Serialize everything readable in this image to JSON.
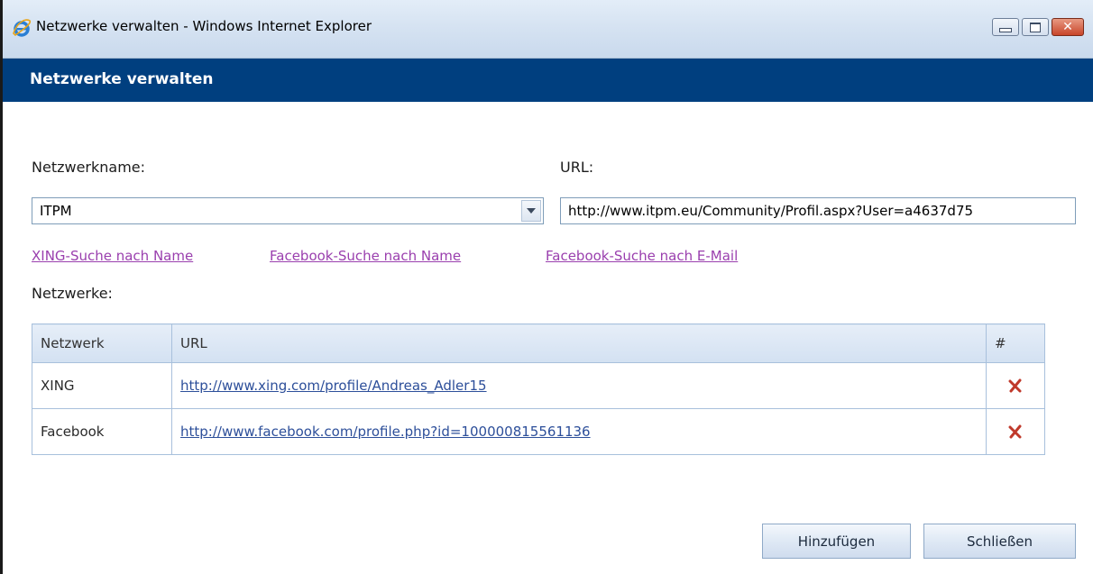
{
  "window": {
    "title": "Netzwerke verwalten - Windows Internet Explorer",
    "close_glyph": "✕"
  },
  "dialog": {
    "header": "Netzwerke verwalten"
  },
  "form": {
    "network_name_label": "Netzwerkname:",
    "network_name_value": "ITPM",
    "url_label": "URL:",
    "url_value": "http://www.itpm.eu/Community/Profil.aspx?User=a4637d75"
  },
  "links": {
    "xing_search": "XING-Suche nach Name",
    "facebook_search_name": "Facebook-Suche nach Name",
    "facebook_search_email": "Facebook-Suche nach E-Mail"
  },
  "networks": {
    "label": "Netzwerke:",
    "columns": [
      "Netzwerk",
      "URL",
      "#"
    ],
    "rows": [
      {
        "network": "XING",
        "url": "http://www.xing.com/profile/Andreas_Adler15"
      },
      {
        "network": "Facebook",
        "url": "http://www.facebook.com/profile.php?id=100000815561136"
      }
    ]
  },
  "buttons": {
    "add": "Hinzufügen",
    "close": "Schließen"
  },
  "colors": {
    "header_band": "#003f7f",
    "visited_link": "#9a3fae",
    "delete_icon": "#c0392b"
  }
}
